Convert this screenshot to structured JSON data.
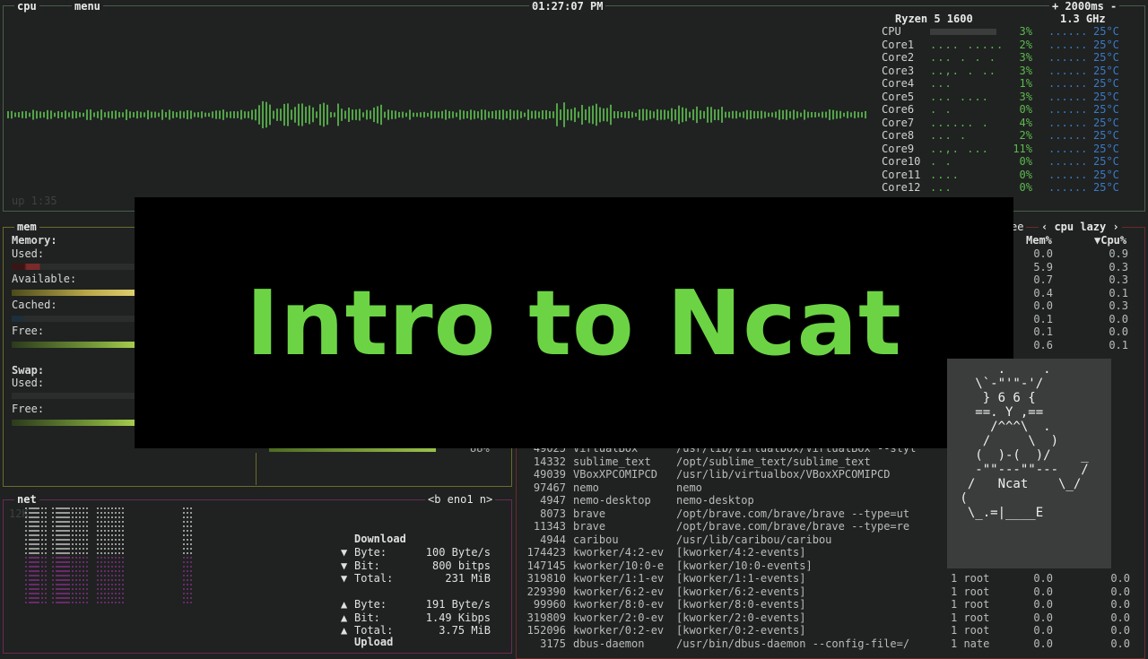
{
  "cpu_box": {
    "label": "cpu",
    "menu_label": "menu",
    "clock": "01:27:07 PM",
    "interval": "+ 2000ms -",
    "cpu_model": "Ryzen 5 1600",
    "freq": "1.3 GHz",
    "uptime": "up 1:35",
    "cores": [
      {
        "name": "CPU",
        "dots": "",
        ".pct": "3%",
        "pct": "3%",
        "temp": "25°C"
      },
      {
        "name": "Core1",
        "dots": ".... .....",
        "pct": "2%",
        "temp": "25°C"
      },
      {
        "name": "Core2",
        "dots": "... . . .",
        "pct": "3%",
        "temp": "25°C"
      },
      {
        "name": "Core3",
        "dots": "..,. . ..",
        "pct": "3%",
        "temp": "25°C"
      },
      {
        "name": "Core4",
        "dots": "...",
        "pct": "1%",
        "temp": "25°C"
      },
      {
        "name": "Core5",
        "dots": "... ....",
        "pct": "3%",
        "temp": "25°C"
      },
      {
        "name": "Core6",
        "dots": ". .",
        "pct": "0%",
        "temp": "25°C"
      },
      {
        "name": "Core7",
        "dots": "...... .",
        "pct": "4%",
        "temp": "25°C"
      },
      {
        "name": "Core8",
        "dots": "... .",
        "pct": "2%",
        "temp": "25°C"
      },
      {
        "name": "Core9",
        "dots": "..,. ...",
        "pct": "11%",
        "temp": "25°C"
      },
      {
        "name": "Core10",
        "dots": ". .",
        "pct": "0%",
        "temp": "25°C"
      },
      {
        "name": "Core11",
        "dots": "....",
        "pct": "0%",
        "temp": "25°C"
      },
      {
        "name": "Core12",
        "dots": "...",
        "pct": "0%",
        "temp": "25°C"
      }
    ]
  },
  "mem_box": {
    "label": "mem",
    "memory_heading": "Memory:",
    "used": "Used:",
    "available": "Available:",
    "cached": "Cached:",
    "free": "Free:",
    "swap_heading": "Swap:",
    "swap_used": "Used:",
    "swap_free": "Free:",
    "disk_pct": "88%"
  },
  "net_box": {
    "label": "net",
    "iface": "<b eno1 n>",
    "scale": "12K",
    "download_heading": "Download",
    "download": [
      {
        "arrow": "▼",
        "key": "Byte:",
        "val": "100 Byte/s"
      },
      {
        "arrow": "▼",
        "key": "Bit:",
        "val": "800 bitps"
      },
      {
        "arrow": "▼",
        "key": "Total:",
        "val": "231 MiB"
      }
    ],
    "upload": [
      {
        "arrow": "▲",
        "key": "Byte:",
        "val": "191 Byte/s"
      },
      {
        "arrow": "▲",
        "key": "Bit:",
        "val": "1.49 Kibps"
      },
      {
        "arrow": "▲",
        "key": "Total:",
        "val": "3.75 MiB"
      }
    ],
    "upload_heading": "Upload"
  },
  "proc_box": {
    "tree_label": "ee",
    "sort_label": "‹ cpu lazy ›",
    "col_mem": "Mem%",
    "col_cpu": "▼Cpu%",
    "side_rows": [
      {
        "mem": "0.0",
        "cpu": "0.9"
      },
      {
        "mem": "5.9",
        "cpu": "0.3"
      },
      {
        "mem": "0.7",
        "cpu": "0.3"
      },
      {
        "mem": "0.4",
        "cpu": "0.1"
      },
      {
        "mem": "0.0",
        "cpu": "0.3"
      },
      {
        "mem": "0.1",
        "cpu": "0.0"
      },
      {
        "mem": "0.1",
        "cpu": "0.0"
      },
      {
        "mem": "0.6",
        "cpu": "0.1"
      }
    ],
    "rows": [
      {
        "pid": "49025",
        "name": "VirtualBox",
        "cmd": "/usr/lib/virtualbox/VirtualBox --styl",
        "user": "",
        "mem": "",
        "cpu": ""
      },
      {
        "pid": "14332",
        "name": "sublime_text",
        "cmd": "/opt/sublime_text/sublime_text",
        "user": "",
        "mem": "",
        "cpu": ""
      },
      {
        "pid": "49039",
        "name": "VBoxXPCOMIPCD",
        "cmd": "/usr/lib/virtualbox/VBoxXPCOMIPCD",
        "user": "",
        "mem": "",
        "cpu": ""
      },
      {
        "pid": "97467",
        "name": "nemo",
        "cmd": "nemo",
        "user": "",
        "mem": "",
        "cpu": ""
      },
      {
        "pid": "4947",
        "name": "nemo-desktop",
        "cmd": "nemo-desktop",
        "user": "",
        "mem": "",
        "cpu": ""
      },
      {
        "pid": "8073",
        "name": "brave",
        "cmd": "/opt/brave.com/brave/brave --type=ut",
        "user": "",
        "mem": "",
        "cpu": ""
      },
      {
        "pid": "11343",
        "name": "brave",
        "cmd": "/opt/brave.com/brave/brave --type=re",
        "user": "",
        "mem": "",
        "cpu": ""
      },
      {
        "pid": "4944",
        "name": "caribou",
        "cmd": "/usr/lib/caribou/caribou",
        "user": "",
        "mem": "",
        "cpu": ""
      },
      {
        "pid": "174423",
        "name": "kworker/4:2-ev",
        "cmd": "[kworker/4:2-events]",
        "user": "",
        "mem": "",
        "cpu": ""
      },
      {
        "pid": "147145",
        "name": "kworker/10:0-e",
        "cmd": "[kworker/10:0-events]",
        "user": "",
        "mem": "",
        "cpu": ""
      },
      {
        "pid": "319810",
        "name": "kworker/1:1-ev",
        "cmd": "[kworker/1:1-events]",
        "user": "1 root",
        "mem": "0.0",
        "cpu": "0.0"
      },
      {
        "pid": "229390",
        "name": "kworker/6:2-ev",
        "cmd": "[kworker/6:2-events]",
        "user": "1 root",
        "mem": "0.0",
        "cpu": "0.0"
      },
      {
        "pid": "99960",
        "name": "kworker/8:0-ev",
        "cmd": "[kworker/8:0-events]",
        "user": "1 root",
        "mem": "0.0",
        "cpu": "0.0"
      },
      {
        "pid": "319809",
        "name": "kworker/2:0-ev",
        "cmd": "[kworker/2:0-events]",
        "user": "1 root",
        "mem": "0.0",
        "cpu": "0.0"
      },
      {
        "pid": "152096",
        "name": "kworker/0:2-ev",
        "cmd": "[kworker/0:2-events]",
        "user": "1 root",
        "mem": "0.0",
        "cpu": "0.0"
      },
      {
        "pid": "3175",
        "name": "dbus-daemon",
        "cmd": "/usr/bin/dbus-daemon --config-file=/",
        "user": "1 nate",
        "mem": "0.0",
        "cpu": "0.0"
      }
    ]
  },
  "overlay": {
    "title": "Intro to Ncat",
    "ascii_art": "      .     .\n   \\`-\"'\"-'/\n    } 6 6 {\n   ==. Y ,==\n     /^^^\\  .\n    /     \\  )\n   (  )-(  )/    _\n   -\"\"---\"\"---   /\n  /   Ncat    \\_/\n (\n  \\_.=|____E"
  },
  "colors": {
    "accent_green": "#6cd444",
    "graph_green": "#5dba4e",
    "temp_blue": "#3b79c6",
    "cpu_frame": "#4a5d4a",
    "mem_frame": "#6d6a2a",
    "net_frame": "#6a2a56",
    "proc_frame": "#6a2a2a"
  }
}
